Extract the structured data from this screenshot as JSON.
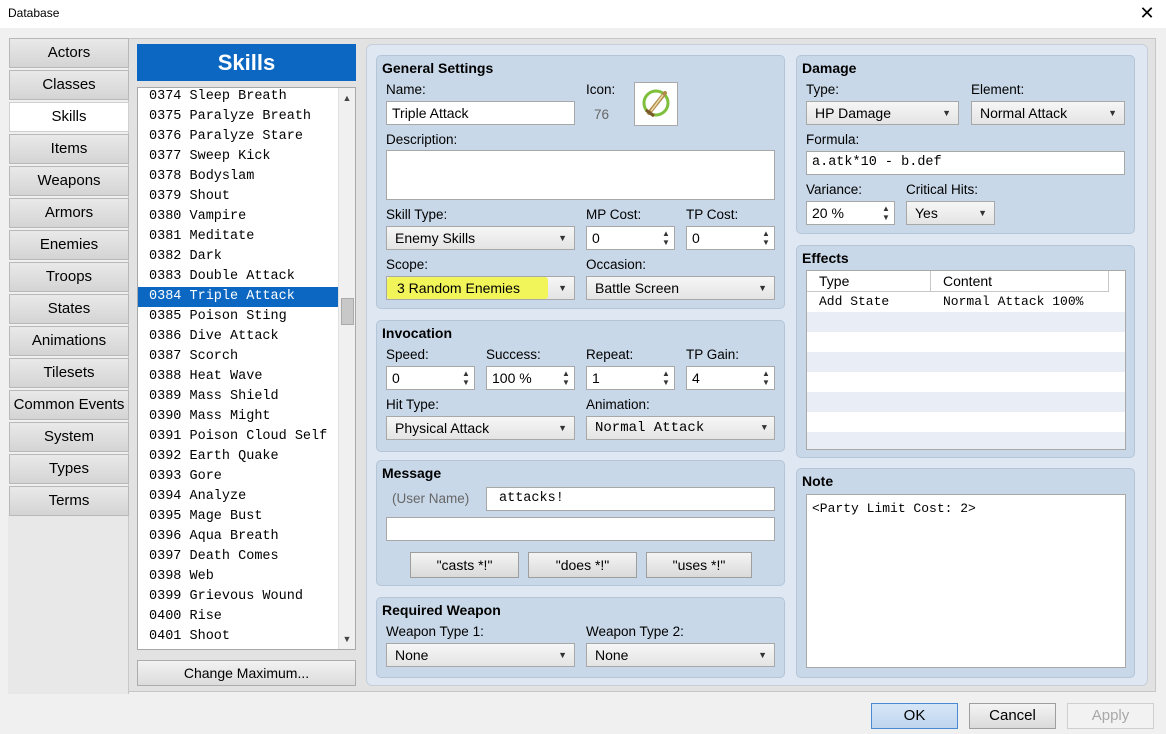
{
  "window": {
    "title": "Database",
    "close_glyph": "✕"
  },
  "categories": [
    "Actors",
    "Classes",
    "Skills",
    "Items",
    "Weapons",
    "Armors",
    "Enemies",
    "Troops",
    "States",
    "Animations",
    "Tilesets",
    "Common Events",
    "System",
    "Types",
    "Terms"
  ],
  "active_category": "Skills",
  "list": {
    "header": "Skills",
    "items": [
      "0374 Sleep Breath",
      "0375 Paralyze Breath",
      "0376 Paralyze Stare",
      "0377 Sweep Kick",
      "0378 Bodyslam",
      "0379 Shout",
      "0380 Vampire",
      "0381 Meditate",
      "0382 Dark",
      "0383 Double Attack",
      "0384 Triple Attack",
      "0385 Poison Sting",
      "0386 Dive Attack",
      "0387 Scorch",
      "0388 Heat Wave",
      "0389 Mass Shield",
      "0390 Mass Might",
      "0391 Poison Cloud Self",
      "0392 Earth Quake",
      "0393 Gore",
      "0394 Analyze",
      "0395 Mage Bust",
      "0396 Aqua Breath",
      "0397 Death Comes",
      "0398 Web",
      "0399 Grievous Wound",
      "0400 Rise",
      "0401 Shoot"
    ],
    "selected": "0384 Triple Attack",
    "change_max_label": "Change Maximum..."
  },
  "general": {
    "title": "General Settings",
    "name_label": "Name:",
    "name_value": "Triple Attack",
    "icon_label": "Icon:",
    "icon_index": "76",
    "description_label": "Description:",
    "description_value": "",
    "skill_type_label": "Skill Type:",
    "skill_type_value": "Enemy Skills",
    "mp_cost_label": "MP Cost:",
    "mp_cost_value": "0",
    "tp_cost_label": "TP Cost:",
    "tp_cost_value": "0",
    "scope_label": "Scope:",
    "scope_value": "3 Random Enemies",
    "occasion_label": "Occasion:",
    "occasion_value": "Battle Screen",
    "highlight_color": "#f2f55a"
  },
  "invocation": {
    "title": "Invocation",
    "speed_label": "Speed:",
    "speed_value": "0",
    "success_label": "Success:",
    "success_value": "100 %",
    "repeat_label": "Repeat:",
    "repeat_value": "1",
    "tp_gain_label": "TP Gain:",
    "tp_gain_value": "4",
    "hit_type_label": "Hit Type:",
    "hit_type_value": "Physical Attack",
    "animation_label": "Animation:",
    "animation_value": "Normal Attack"
  },
  "message": {
    "title": "Message",
    "user_name_label": "(User Name)",
    "line1_value": "attacks!",
    "line2_value": "",
    "casts_label": "\"casts *!\"",
    "does_label": "\"does *!\"",
    "uses_label": "\"uses *!\""
  },
  "required_weapon": {
    "title": "Required Weapon",
    "type1_label": "Weapon Type 1:",
    "type1_value": "None",
    "type2_label": "Weapon Type 2:",
    "type2_value": "None"
  },
  "damage": {
    "title": "Damage",
    "type_label": "Type:",
    "type_value": "HP Damage",
    "element_label": "Element:",
    "element_value": "Normal Attack",
    "formula_label": "Formula:",
    "formula_value": "a.atk*10 - b.def",
    "variance_label": "Variance:",
    "variance_value": "20 %",
    "critical_label": "Critical Hits:",
    "critical_value": "Yes"
  },
  "effects": {
    "title": "Effects",
    "col_type": "Type",
    "col_content": "Content",
    "rows": [
      {
        "type": "Add State",
        "content": "Normal Attack 100%"
      }
    ]
  },
  "note": {
    "title": "Note",
    "value": "<Party Limit Cost: 2>"
  },
  "footer": {
    "ok": "OK",
    "cancel": "Cancel",
    "apply": "Apply"
  }
}
